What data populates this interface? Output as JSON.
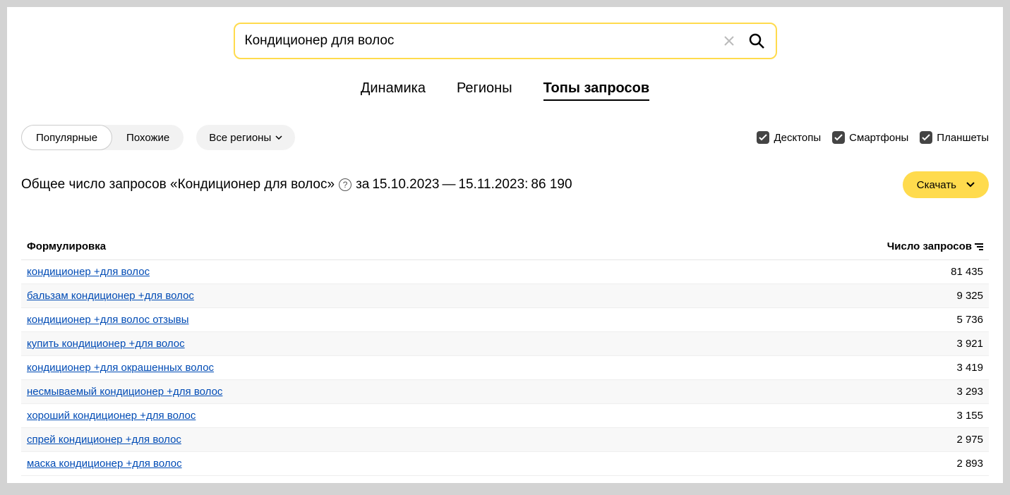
{
  "search": {
    "value": "Кондиционер для волос"
  },
  "tabs": {
    "dynamics": "Динамика",
    "regions": "Регионы",
    "top_queries": "Топы запросов"
  },
  "segment": {
    "popular": "Популярные",
    "similar": "Похожие"
  },
  "region_filter": "Все регионы",
  "devices": {
    "desktop": "Десктопы",
    "smartphone": "Смартфоны",
    "tablet": "Планшеты"
  },
  "summary": {
    "prefix": "Общее число запросов «Кондиционер для волос»",
    "range_prefix": "за",
    "date_from": "15.10.2023",
    "dash": "—",
    "date_to": "15.11.2023:",
    "total": "86 190"
  },
  "download_label": "Скачать",
  "table": {
    "header_query": "Формулировка",
    "header_count": "Число запросов",
    "rows": [
      {
        "query": "кондиционер +для волос",
        "count": "81 435"
      },
      {
        "query": "бальзам кондиционер +для волос",
        "count": "9 325"
      },
      {
        "query": "кондиционер +для волос отзывы",
        "count": "5 736"
      },
      {
        "query": "купить кондиционер +для волос",
        "count": "3 921"
      },
      {
        "query": "кондиционер +для окрашенных волос",
        "count": "3 419"
      },
      {
        "query": "несмываемый кондиционер +для волос",
        "count": "3 293"
      },
      {
        "query": "хороший кондиционер +для волос",
        "count": "3 155"
      },
      {
        "query": "спрей кондиционер +для волос",
        "count": "2 975"
      },
      {
        "query": "маска кондиционер +для волос",
        "count": "2 893"
      }
    ]
  }
}
